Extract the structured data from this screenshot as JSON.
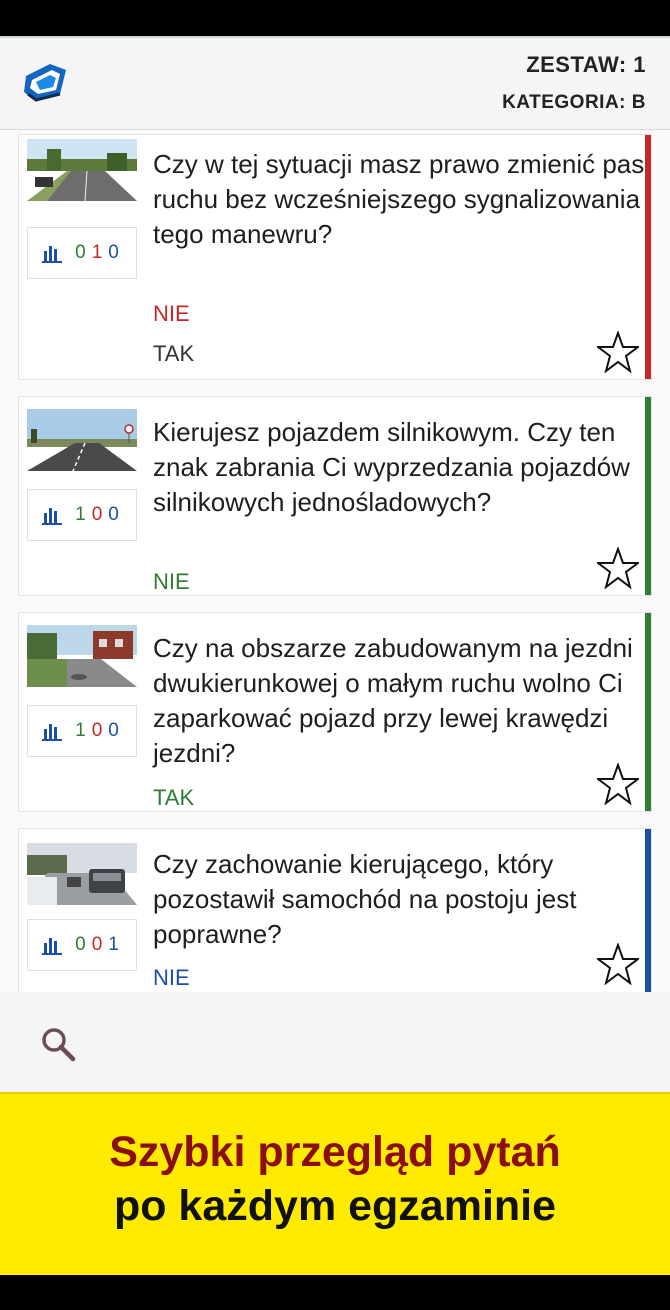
{
  "header": {
    "zestaw": "ZESTAW: 1",
    "kategoria": "KATEGORIA: B"
  },
  "colors": {
    "wrong": "#c62828",
    "correct": "#2e7d32",
    "neutral": "#1e4fa8",
    "promo_bg": "#ffeb00"
  },
  "questions": [
    {
      "text": "Czy w tej sytuacji masz prawo zmienić pas ruchu bez wcześniejszego sygnalizowania tego manewru?",
      "stats": [
        "0",
        "1",
        "0"
      ],
      "answer": "NIE",
      "correct_answer": "TAK",
      "status": "wrong"
    },
    {
      "text": "Kierujesz pojazdem silnikowym. Czy ten znak zabrania Ci wyprzedzania pojazdów silnikowych jednośladowych?",
      "stats": [
        "1",
        "0",
        "0"
      ],
      "answer": "NIE",
      "status": "correct"
    },
    {
      "text": "Czy na obszarze zabudowanym na jezdni dwukierunkowej o małym ruchu wolno Ci zaparkować pojazd przy lewej krawędzi jezdni?",
      "stats": [
        "1",
        "0",
        "0"
      ],
      "answer": "TAK",
      "status": "correct"
    },
    {
      "text": "Czy zachowanie kierującego, który pozostawił samochód na postoju jest poprawne?",
      "stats": [
        "0",
        "0",
        "1"
      ],
      "answer": "NIE",
      "status": "neutral"
    }
  ],
  "icons": {
    "logo": "app-logo-icon",
    "search": "search-icon",
    "star": "star-outline-icon",
    "stats": "bar-chart-icon"
  },
  "promo": {
    "line1": "Szybki przegląd pytań",
    "line2": "po każdym egzaminie"
  }
}
